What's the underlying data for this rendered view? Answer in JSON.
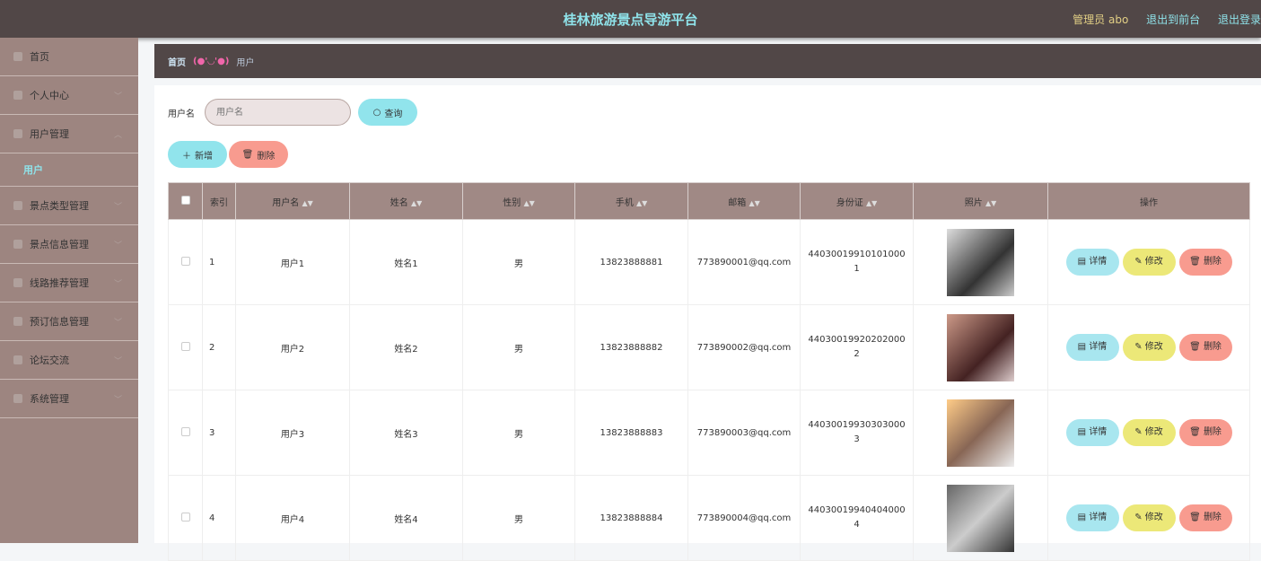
{
  "header": {
    "title": "桂林旅游景点导游平台",
    "admin": "管理员 abo",
    "to_front": "退出到前台",
    "logout": "退出登录"
  },
  "sidebar": {
    "items": [
      {
        "label": "首页",
        "icon": "home-icon"
      },
      {
        "label": "个人中心",
        "icon": "user-icon"
      },
      {
        "label": "用户管理",
        "icon": "users-icon",
        "expanded": true,
        "children": [
          "用户"
        ]
      },
      {
        "label": "景点类型管理",
        "icon": "list-icon"
      },
      {
        "label": "景点信息管理",
        "icon": "list-icon"
      },
      {
        "label": "线路推荐管理",
        "icon": "route-icon"
      },
      {
        "label": "预订信息管理",
        "icon": "order-icon"
      },
      {
        "label": "论坛交流",
        "icon": "forum-icon"
      },
      {
        "label": "系统管理",
        "icon": "settings-icon"
      }
    ]
  },
  "breadcrumb": {
    "home": "首页",
    "sep": "(●'◡'●)",
    "current": "用户"
  },
  "search": {
    "label": "用户名",
    "placeholder": "用户名",
    "button": "查询"
  },
  "actions": {
    "add": "新增",
    "delete": "删除"
  },
  "table": {
    "headers": [
      "索引",
      "用户名",
      "姓名",
      "性别",
      "手机",
      "邮箱",
      "身份证",
      "照片",
      "操作"
    ],
    "rows": [
      {
        "index": "1",
        "username": "用户1",
        "name": "姓名1",
        "gender": "男",
        "phone": "13823888881",
        "email": "773890001@qq.com",
        "idcard": "440300199101010001"
      },
      {
        "index": "2",
        "username": "用户2",
        "name": "姓名2",
        "gender": "男",
        "phone": "13823888882",
        "email": "773890002@qq.com",
        "idcard": "440300199202020002"
      },
      {
        "index": "3",
        "username": "用户3",
        "name": "姓名3",
        "gender": "男",
        "phone": "13823888883",
        "email": "773890003@qq.com",
        "idcard": "440300199303030003"
      },
      {
        "index": "4",
        "username": "用户4",
        "name": "姓名4",
        "gender": "男",
        "phone": "13823888884",
        "email": "773890004@qq.com",
        "idcard": "440300199404040004"
      }
    ],
    "row_actions": {
      "detail": "详情",
      "edit": "修改",
      "delete": "删除"
    }
  },
  "colors": {
    "header_bg": "#514747",
    "sidebar_bg": "#9d8580",
    "accent_cyan": "#8fe3ea",
    "yellow": "#ece878",
    "red": "#f89b8f"
  }
}
